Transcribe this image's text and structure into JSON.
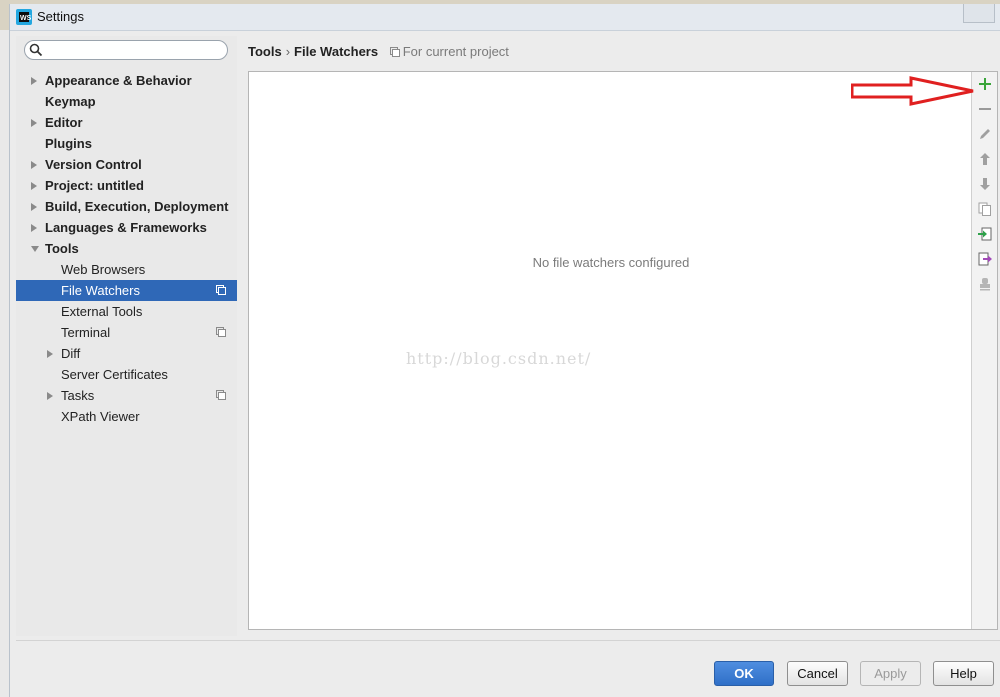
{
  "window": {
    "title": "Settings"
  },
  "search": {
    "placeholder": "",
    "value": ""
  },
  "tree": [
    {
      "label": "Appearance & Behavior",
      "level": 0,
      "expander": "collapsed"
    },
    {
      "label": "Keymap",
      "level": 0,
      "expander": "none"
    },
    {
      "label": "Editor",
      "level": 0,
      "expander": "collapsed"
    },
    {
      "label": "Plugins",
      "level": 0,
      "expander": "none"
    },
    {
      "label": "Version Control",
      "level": 0,
      "expander": "collapsed"
    },
    {
      "label": "Project: untitled",
      "level": 0,
      "expander": "collapsed"
    },
    {
      "label": "Build, Execution, Deployment",
      "level": 0,
      "expander": "collapsed"
    },
    {
      "label": "Languages & Frameworks",
      "level": 0,
      "expander": "collapsed"
    },
    {
      "label": "Tools",
      "level": 0,
      "expander": "expanded"
    },
    {
      "label": "Web Browsers",
      "level": 1,
      "expander": "none"
    },
    {
      "label": "File Watchers",
      "level": 1,
      "expander": "none",
      "selected": true,
      "project_icon": true
    },
    {
      "label": "External Tools",
      "level": 1,
      "expander": "none"
    },
    {
      "label": "Terminal",
      "level": 1,
      "expander": "none",
      "project_icon": true
    },
    {
      "label": "Diff",
      "level": 1,
      "expander": "collapsed"
    },
    {
      "label": "Server Certificates",
      "level": 1,
      "expander": "none"
    },
    {
      "label": "Tasks",
      "level": 1,
      "expander": "collapsed",
      "project_icon": true
    },
    {
      "label": "XPath Viewer",
      "level": 1,
      "expander": "none"
    }
  ],
  "breadcrumb": {
    "parent": "Tools",
    "separator": "›",
    "current": "File Watchers",
    "scope": "For current project"
  },
  "content": {
    "empty_text": "No file watchers configured",
    "watermark": "http://blog.csdn.net/"
  },
  "toolbar": [
    {
      "icon": "add-icon",
      "enabled": true
    },
    {
      "icon": "remove-icon",
      "enabled": false
    },
    {
      "icon": "edit-icon",
      "enabled": false
    },
    {
      "icon": "move-up-icon",
      "enabled": false
    },
    {
      "icon": "move-down-icon",
      "enabled": false
    },
    {
      "icon": "copy-icon",
      "enabled": false
    },
    {
      "icon": "import-icon",
      "enabled": true
    },
    {
      "icon": "export-icon",
      "enabled": true
    },
    {
      "icon": "stamp-icon",
      "enabled": false
    }
  ],
  "buttons": {
    "ok": "OK",
    "cancel": "Cancel",
    "apply": "Apply",
    "help": "Help"
  },
  "colors": {
    "selection": "#2f68b7",
    "ok_button": "#3b7dd8",
    "annotation_arrow": "#e02020",
    "add_icon": "#3aa53a"
  }
}
